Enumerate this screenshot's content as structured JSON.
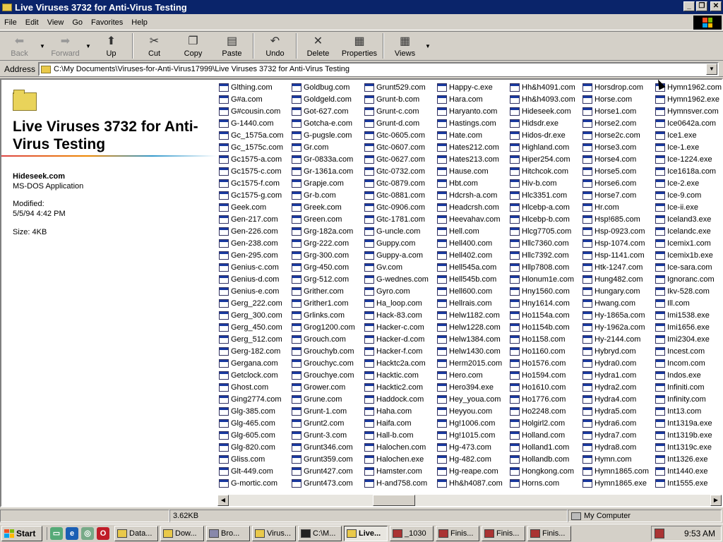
{
  "window": {
    "title": "Live Viruses 3732 for Anti-Virus Testing",
    "controls": [
      "_",
      "❐",
      "✕"
    ]
  },
  "menu": [
    "File",
    "Edit",
    "View",
    "Go",
    "Favorites",
    "Help"
  ],
  "toolbar": {
    "back": "Back",
    "forward": "Forward",
    "up": "Up",
    "cut": "Cut",
    "copy": "Copy",
    "paste": "Paste",
    "undo": "Undo",
    "delete": "Delete",
    "properties": "Properties",
    "views": "Views"
  },
  "address": {
    "label": "Address",
    "path": "C:\\My Documents\\Viruses-for-Anti-Virus17999\\Live Viruses 3732 for Anti-Virus Testing"
  },
  "leftpane": {
    "folder_title": "Live Viruses 3732 for Anti-Virus Testing",
    "selected_name": "Hideseek.com",
    "selected_type": "MS-DOS Application",
    "modified_label": "Modified:",
    "modified_value": "5/5/94 4:42 PM",
    "size": "Size: 4KB"
  },
  "files": [
    "Glthing.com",
    "G#a.com",
    "G#cousin.com",
    "G-1440.com",
    "Gc_1575a.com",
    "Gc_1575c.com",
    "Gc1575-a.com",
    "Gc1575-c.com",
    "Gc1575-f.com",
    "Gc1575-g.com",
    "Geek.com",
    "Gen-217.com",
    "Gen-226.com",
    "Gen-238.com",
    "Gen-295.com",
    "Genius-c.com",
    "Genius-d.com",
    "Genius-e.com",
    "Gerg_222.com",
    "Gerg_300.com",
    "Gerg_450.com",
    "Gerg_512.com",
    "Gerg-182.com",
    "Gergana.com",
    "Getclock.com",
    "Ghost.com",
    "Ging2774.com",
    "Glg-385.com",
    "Glg-465.com",
    "Glg-605.com",
    "Glg-820.com",
    "Gliss.com",
    "Glt-449.com",
    "G-mortic.com",
    "Goldbug.com",
    "Goldgeld.com",
    "Got-627.com",
    "Gotcha-e.com",
    "G-pugsle.com",
    "Gr.com",
    "Gr-0833a.com",
    "Gr-1361a.com",
    "Grapje.com",
    "Gr-b.com",
    "Greek.com",
    "Green.com",
    "Grg-182a.com",
    "Grg-222.com",
    "Grg-300.com",
    "Grg-450.com",
    "Grg-512.com",
    "Grither.com",
    "Grither1.com",
    "Grlinks.com",
    "Grog1200.com",
    "Grouch.com",
    "Grouchyb.com",
    "Grouchyc.com",
    "Grouchye.com",
    "Grower.com",
    "Grune.com",
    "Grunt-1.com",
    "Grunt2.com",
    "Grunt-3.com",
    "Grunt346.com",
    "Grunt359.com",
    "Grunt427.com",
    "Grunt473.com",
    "Grunt529.com",
    "Grunt-b.com",
    "Grunt-c.com",
    "Grunt-d.com",
    "Gtc-0605.com",
    "Gtc-0607.com",
    "Gtc-0627.com",
    "Gtc-0732.com",
    "Gtc-0879.com",
    "Gtc-0881.com",
    "Gtc-0906.com",
    "Gtc-1781.com",
    "G-uncle.com",
    "Guppy.com",
    "Guppy-a.com",
    "Gv.com",
    "G-wednes.com",
    "Gyro.com",
    "Ha_loop.com",
    "Hack-83.com",
    "Hacker-c.com",
    "Hacker-d.com",
    "Hacker-f.com",
    "Hacktc2a.com",
    "Hacktic.com",
    "Hacktic2.com",
    "Haddock.com",
    "Haha.com",
    "Haifa.com",
    "Hall-b.com",
    "Halochen.com",
    "Halochen.exe",
    "Hamster.com",
    "H-and758.com",
    "Happy-c.exe",
    "Hara.com",
    "Haryanto.com",
    "Hastings.com",
    "Hate.com",
    "Hates212.com",
    "Hates213.com",
    "Hause.com",
    "Hbt.com",
    "Hdcrsh-a.com",
    "Headcrsh.com",
    "Heevahav.com",
    "Hell.com",
    "Hell400.com",
    "Hell402.com",
    "Hell545a.com",
    "Hell545b.com",
    "Hell600.com",
    "Hellrais.com",
    "Helw1182.com",
    "Helw1228.com",
    "Helw1384.com",
    "Helw1430.com",
    "Herm2015.com",
    "Hero.com",
    "Hero394.exe",
    "Hey_youa.com",
    "Heyyou.com",
    "Hg!1006.com",
    "Hg!1015.com",
    "Hg-473.com",
    "Hg-482.com",
    "Hg-reape.com",
    "Hh&h4087.com",
    "Hh&h4091.com",
    "Hh&h4093.com",
    "Hideseek.com",
    "Hidsdr.exe",
    "Hidos-dr.exe",
    "Highland.com",
    "Hiper254.com",
    "Hitchcok.com",
    "Hiv-b.com",
    "Hlc3351.com",
    "Hlcebp-a.com",
    "Hlcebp-b.com",
    "Hlcg7705.com",
    "Hllc7360.com",
    "Hllc7392.com",
    "Hllp7808.com",
    "Hlonum1e.com",
    "Hny1560.com",
    "Hny1614.com",
    "Ho1154a.com",
    "Ho1154b.com",
    "Ho1158.com",
    "Ho1160.com",
    "Ho1576.com",
    "Ho1594.com",
    "Ho1610.com",
    "Ho1776.com",
    "Ho2248.com",
    "Holgirl2.com",
    "Holland.com",
    "Holland1.com",
    "Hollandb.com",
    "Hongkong.com",
    "Horns.com",
    "Horsdrop.com",
    "Horse.com",
    "Horse1.com",
    "Horse2.com",
    "Horse2c.com",
    "Horse3.com",
    "Horse4.com",
    "Horse5.com",
    "Horse6.com",
    "Horse7.com",
    "Hr.com",
    "Hsp!685.com",
    "Hsp-0923.com",
    "Hsp-1074.com",
    "Hsp-1141.com",
    "Htk-1247.com",
    "Hung482.com",
    "Hungary.com",
    "Hwang.com",
    "Hy-1865a.com",
    "Hy-1962a.com",
    "Hy-2144.com",
    "Hybryd.com",
    "Hydra0.com",
    "Hydra1.com",
    "Hydra2.com",
    "Hydra4.com",
    "Hydra5.com",
    "Hydra6.com",
    "Hydra7.com",
    "Hydra8.com",
    "Hymn.com",
    "Hymn1865.com",
    "Hymn1865.exe",
    "Hymn1962.com",
    "Hymn1962.exe",
    "Hymnsver.com",
    "Ice0642a.com",
    "Ice1.exe",
    "Ice-1.exe",
    "Ice-1224.exe",
    "Ice1618a.com",
    "Ice-2.exe",
    "Ice-9.com",
    "Ice-ii.exe",
    "Iceland3.exe",
    "Icelandc.exe",
    "Icemix1.com",
    "Icemix1b.exe",
    "Ice-sara.com",
    "Ignoranc.com",
    "Ikv-528.com",
    "Ill.com",
    "Imi1538.exe",
    "Imi1656.exe",
    "Imi2304.exe",
    "Incest.com",
    "Incom.com",
    "Indos.exe",
    "Infiniti.com",
    "Infinity.com",
    "Int13.com",
    "Int1319a.exe",
    "Int1319b.exe",
    "Int1319c.exe",
    "Int1326.exe",
    "Int1440.exe",
    "Int1555.exe"
  ],
  "status": {
    "size": "3.62KB",
    "zone": "My Computer"
  },
  "taskbar": {
    "start": "Start",
    "tasks": [
      "Data...",
      "Dow...",
      "Bro...",
      "Virus...",
      "C:\\M...",
      "Live...",
      "_1030",
      "Finis...",
      "Finis...",
      "Finis..."
    ],
    "clock": "9:53 AM"
  },
  "colors": {
    "titlebar": "#0a246a",
    "face": "#d4d0c8"
  }
}
